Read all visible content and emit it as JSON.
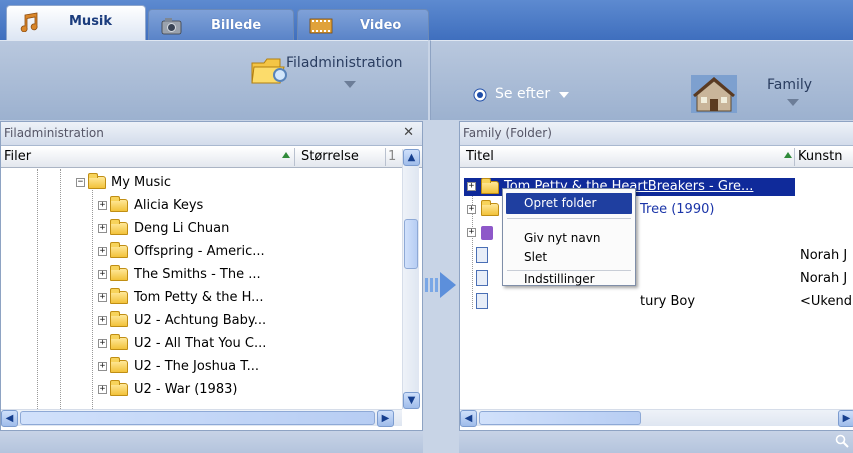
{
  "tabs": [
    {
      "label": "Musik",
      "icon": "music-notes-icon",
      "active": true
    },
    {
      "label": "Billede",
      "icon": "camera-icon",
      "active": false
    },
    {
      "label": "Video",
      "icon": "film-icon",
      "active": false
    }
  ],
  "left_toolbar": {
    "button_label": "Filadministration"
  },
  "right_toolbar": {
    "view_label": "Se efter",
    "family_label": "Family"
  },
  "left_panel": {
    "title": "Filadministration",
    "close_glyph": "✕",
    "columns": [
      "Filer",
      "Størrelse",
      "1"
    ],
    "root": "My Music",
    "items": [
      "Alicia Keys",
      "Deng Li Chuan",
      "Offspring - Americ...",
      "The Smiths - The ...",
      "Tom Petty & the H...",
      "U2 - Achtung Baby...",
      "U2 - All That You C...",
      "U2 - The Joshua T...",
      "U2 - War (1983)"
    ],
    "vertical_scroll_fraction": 0.3,
    "horizontal_scroll_fraction": 0.0
  },
  "right_panel": {
    "title": "Family (Folder)",
    "columns": [
      "Titel",
      "Kunstn"
    ],
    "rows": [
      {
        "title": "Tom Petty & the HeartBreakers - Gre...",
        "artist": "",
        "selected": true
      },
      {
        "title": "Tree (1990)",
        "artist": "",
        "selected": false
      },
      {
        "title": "",
        "artist": "",
        "selected": false
      },
      {
        "title": "",
        "artist": "Norah J",
        "selected": false
      },
      {
        "title": "",
        "artist": "Norah J",
        "selected": false
      },
      {
        "title": "tury Boy",
        "artist": "<Ukend",
        "selected": false
      }
    ]
  },
  "context_menu": {
    "items": [
      "Opret folder",
      "Giv nyt navn",
      "Slet",
      "Indstillinger"
    ],
    "highlighted": "Opret folder"
  },
  "colors": {
    "tab_strip": "#4a78c4",
    "selection": "#0f2a9a",
    "toolbar": "#a9bdd8",
    "folder": "#f2c23a"
  }
}
